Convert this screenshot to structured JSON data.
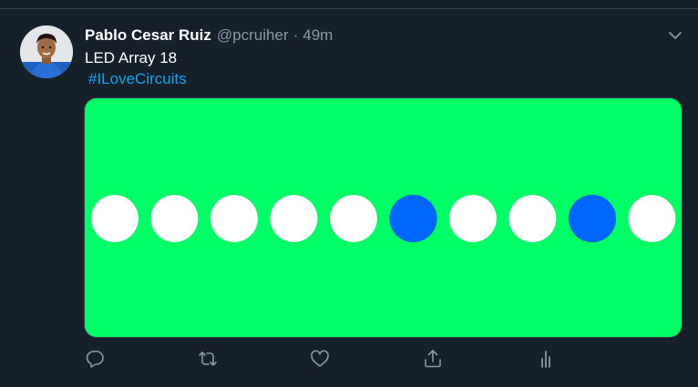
{
  "tweet": {
    "display_name": "Pablo Cesar Ruiz",
    "handle": "@pcruiher",
    "separator": "·",
    "time": "49m",
    "text": "LED Array 18",
    "hashtag": "#ILoveCircuits"
  },
  "media": {
    "background_color": "#00ff66",
    "led_on_color": "#0066ff",
    "led_off_color": "#ffffff",
    "leds": [
      "off",
      "off",
      "off",
      "off",
      "off",
      "on",
      "off",
      "off",
      "on",
      "off"
    ]
  },
  "actions": {
    "icons": [
      "reply-icon",
      "retweet-icon",
      "like-icon",
      "share-icon",
      "analytics-icon"
    ]
  },
  "colors": {
    "background": "#15202b",
    "text": "#ffffff",
    "secondary_text": "#8899a6",
    "link": "#1da1f2"
  }
}
